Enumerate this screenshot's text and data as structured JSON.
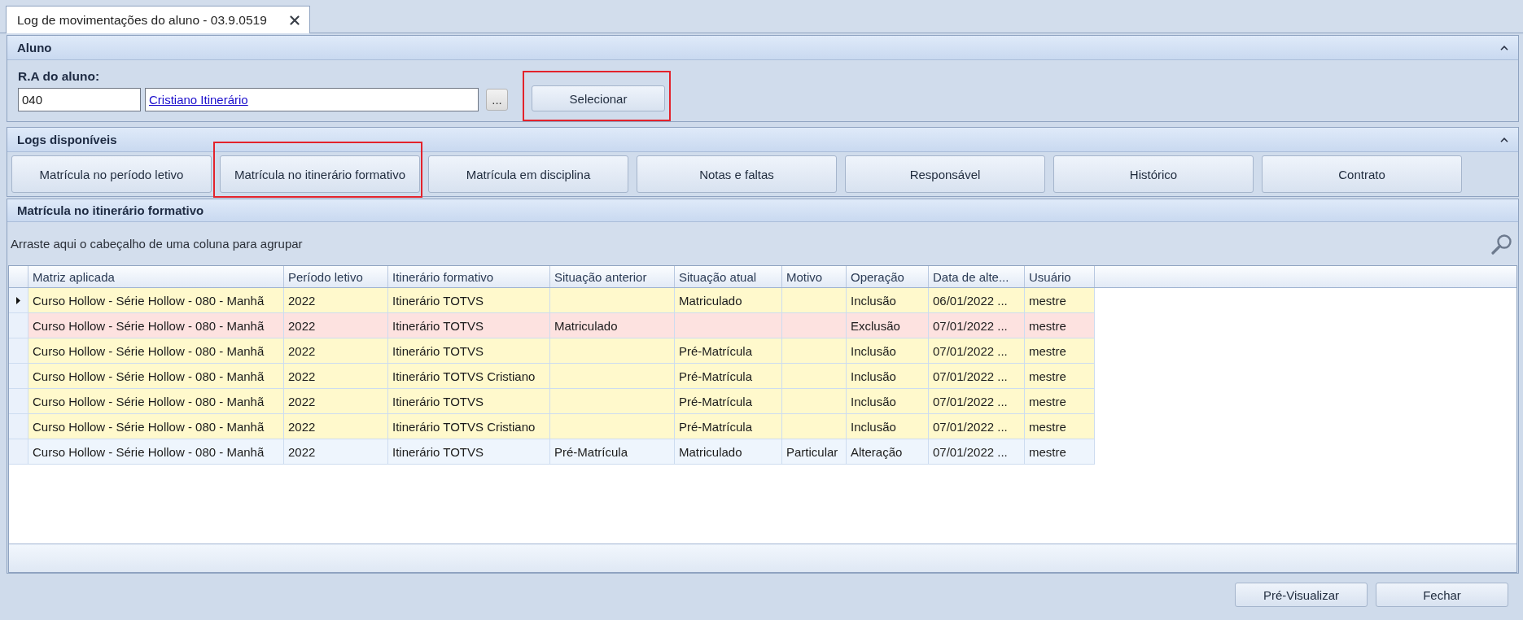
{
  "tabs": [
    {
      "title": "Log de movimentações do aluno - 03.9.0519",
      "selected": true
    }
  ],
  "aluno_panel": {
    "title": "Aluno",
    "ra_label": "R.A do aluno:",
    "ra_value": "040",
    "student_name": "Cristiano Itinerário",
    "browse_button": "...",
    "select_button": {
      "label": "Selecionar",
      "highlighted": true
    }
  },
  "logs_panel": {
    "title": "Logs disponíveis",
    "buttons": [
      {
        "label": "Matrícula no período letivo",
        "highlighted": false
      },
      {
        "label": "Matrícula no itinerário formativo",
        "highlighted": true
      },
      {
        "label": "Matrícula em disciplina",
        "highlighted": false
      },
      {
        "label": "Notas e faltas",
        "highlighted": false
      },
      {
        "label": "Responsável",
        "highlighted": false
      },
      {
        "label": "Histórico",
        "highlighted": false
      },
      {
        "label": "Contrato",
        "highlighted": false
      }
    ]
  },
  "grid_panel": {
    "title": "Matrícula no itinerário formativo",
    "group_hint": "Arraste aqui o cabeçalho de uma coluna para agrupar",
    "columns": [
      "Matriz aplicada",
      "Período letivo",
      "Itinerário formativo",
      "Situação anterior",
      "Situação atual",
      "Motivo",
      "Operação",
      "Data de alte...",
      "Usuário"
    ],
    "rows": [
      {
        "selected": true,
        "color": "#fff9cc",
        "cells": [
          "Curso Hollow - Série Hollow - 080 - Manhã",
          "2022",
          "Itinerário TOTVS",
          null,
          "Matriculado",
          null,
          "Inclusão",
          "06/01/2022 ...",
          "mestre"
        ]
      },
      {
        "selected": false,
        "color": "#fde2e0",
        "cells": [
          "Curso Hollow - Série Hollow - 080 - Manhã",
          "2022",
          "Itinerário TOTVS",
          "Matriculado",
          null,
          null,
          "Exclusão",
          "07/01/2022 ...",
          "mestre"
        ]
      },
      {
        "selected": false,
        "color": "#fff9cc",
        "cells": [
          "Curso Hollow - Série Hollow - 080 - Manhã",
          "2022",
          "Itinerário TOTVS",
          null,
          "Pré-Matrícula",
          null,
          "Inclusão",
          "07/01/2022 ...",
          "mestre"
        ]
      },
      {
        "selected": false,
        "color": "#fff9cc",
        "cells": [
          "Curso Hollow - Série Hollow - 080 - Manhã",
          "2022",
          "Itinerário TOTVS Cristiano",
          null,
          "Pré-Matrícula",
          null,
          "Inclusão",
          "07/01/2022 ...",
          "mestre"
        ]
      },
      {
        "selected": false,
        "color": "#fff9cc",
        "cells": [
          "Curso Hollow - Série Hollow - 080 - Manhã",
          "2022",
          "Itinerário TOTVS",
          null,
          "Pré-Matrícula",
          null,
          "Inclusão",
          "07/01/2022 ...",
          "mestre"
        ]
      },
      {
        "selected": false,
        "color": "#fff9cc",
        "cells": [
          "Curso Hollow - Série Hollow - 080 - Manhã",
          "2022",
          "Itinerário TOTVS Cristiano",
          null,
          "Pré-Matrícula",
          null,
          "Inclusão",
          "07/01/2022 ...",
          "mestre"
        ]
      },
      {
        "selected": false,
        "color": "#eef5fd",
        "cells": [
          "Curso Hollow - Série Hollow - 080 - Manhã",
          "2022",
          "Itinerário TOTVS",
          "Pré-Matrícula",
          "Matriculado",
          "Particular",
          "Alteração",
          "07/01/2022 ...",
          "mestre"
        ]
      }
    ]
  },
  "footer_buttons": [
    "Pré-Visualizar",
    "Fechar"
  ]
}
